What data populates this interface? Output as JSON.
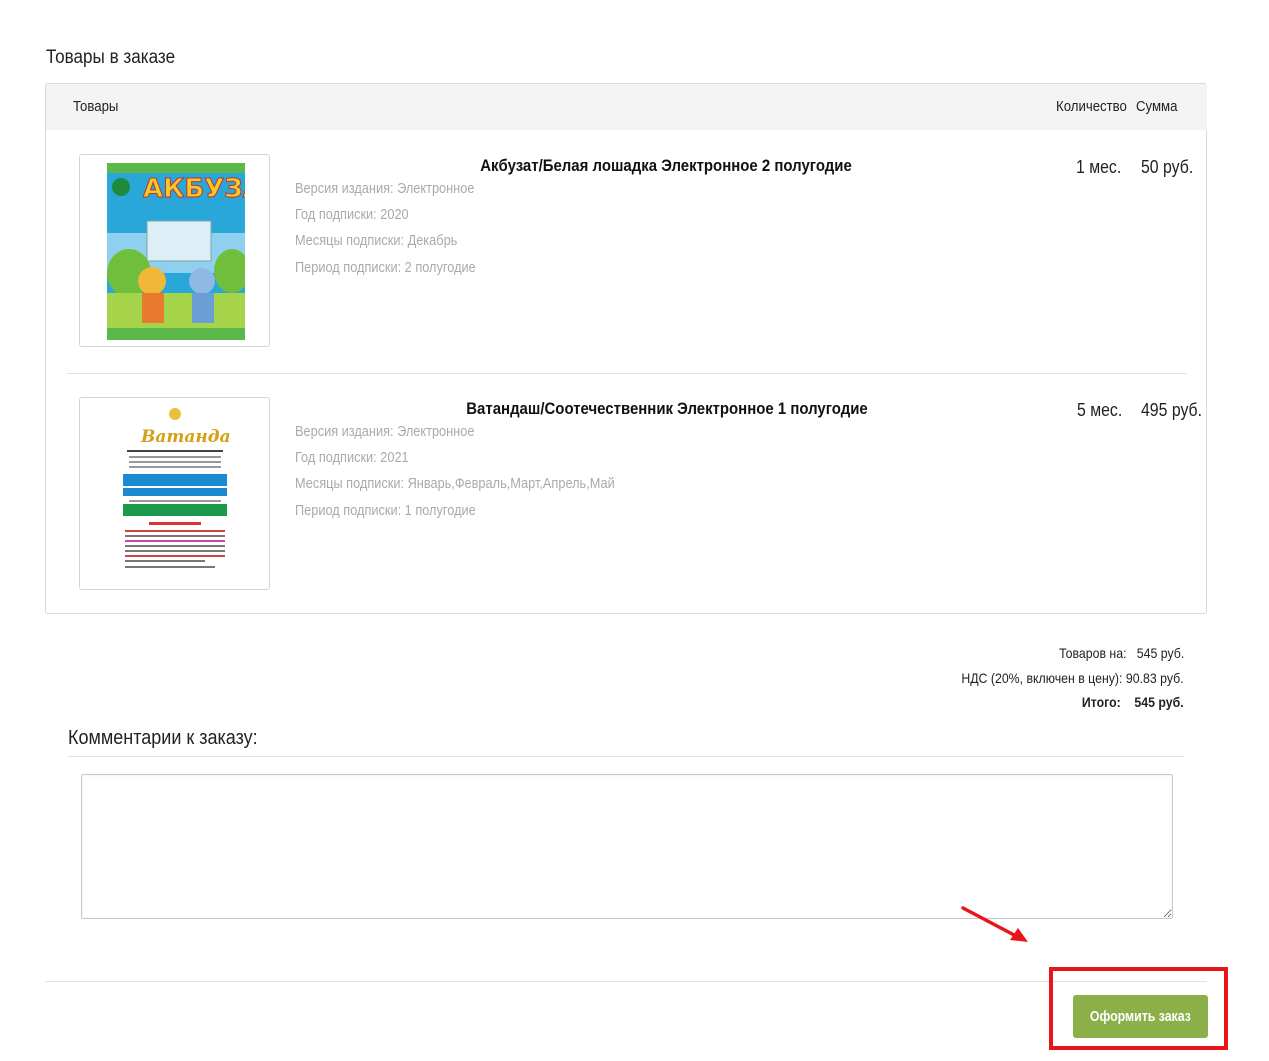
{
  "section_title": "Товары в заказе",
  "table_headers": {
    "products": "Товары",
    "quantity": "Количество",
    "sum": "Сумма"
  },
  "items": [
    {
      "title": "Акбузат/Белая лошадка Электронное 2 полугодие",
      "props": [
        "Версия издания: Электронное",
        "Год подписки: 2020",
        "Месяцы подписки: Декабрь",
        "Период подписки: 2 полугодие"
      ],
      "qty": "1 мес.",
      "sum": "50 руб.",
      "cover_text": "Акбузат"
    },
    {
      "title": "Ватандаш/Соотечественник Электронное 1 полугодие",
      "props": [
        "Версия издания: Электронное",
        "Год подписки: 2021",
        "Месяцы подписки: Январь,Февраль,Март,Апрель,Май",
        "Период подписки: 1 полугодие"
      ],
      "qty": "5 мес.",
      "sum": "495 руб.",
      "cover_text": "Ватандаш"
    }
  ],
  "totals": {
    "goods_label": "Товаров на:",
    "goods_value": "545 руб.",
    "vat_label": "НДС (20%, включен в цену):",
    "vat_value": "90.83 руб.",
    "total_label": "Итого:",
    "total_value": "545 руб."
  },
  "comment": {
    "title": "Комментарии к заказу:",
    "value": ""
  },
  "order_button": "Оформить заказ",
  "colors": {
    "button": "#8bb04a",
    "highlight": "#e8151b",
    "header_bg": "#f4f4f4"
  }
}
